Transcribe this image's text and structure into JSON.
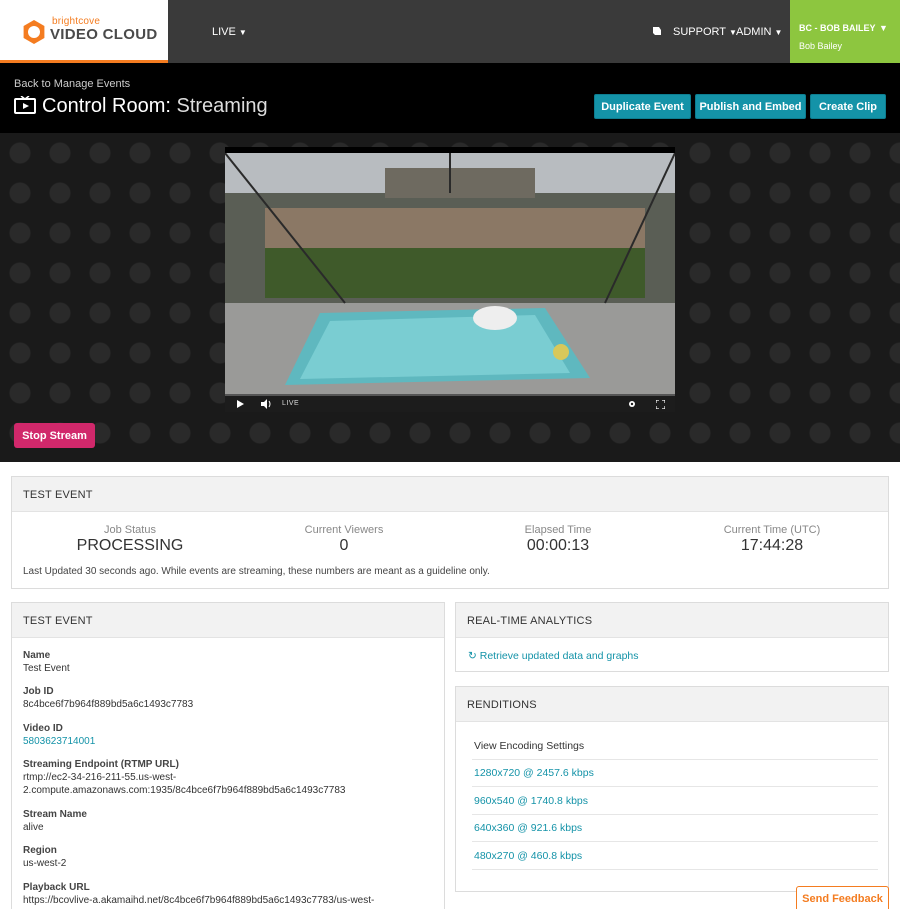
{
  "nav": {
    "logo_small": "brightcove",
    "logo_main": "VIDEO CLOUD",
    "live": "LIVE",
    "support": "SUPPORT",
    "admin": "ADMIN",
    "user_account": "BC - BOB BAILEY",
    "user_name": "Bob Bailey",
    "caret": "▼"
  },
  "header": {
    "back": "Back to Manage Events",
    "title_main": "Control Room:",
    "title_sub": "Streaming",
    "buttons": {
      "duplicate": "Duplicate Event",
      "publish": "Publish and Embed",
      "clip": "Create Clip"
    }
  },
  "player": {
    "live_label": "LIVE",
    "stop_label": "Stop Stream"
  },
  "status_panel": {
    "title": "TEST EVENT",
    "stats": [
      {
        "label": "Job Status",
        "value": "PROCESSING"
      },
      {
        "label": "Current Viewers",
        "value": "0"
      },
      {
        "label": "Elapsed Time",
        "value": "00:00:13"
      },
      {
        "label": "Current Time (UTC)",
        "value": "17:44:28"
      }
    ],
    "note": "Last Updated 30 seconds ago. While events are streaming, these numbers are meant as a guideline only."
  },
  "details_panel": {
    "title": "TEST EVENT",
    "fields": [
      {
        "label": "Name",
        "value": "Test Event"
      },
      {
        "label": "Job ID",
        "value": "8c4bce6f7b964f889bd5a6c1493c7783"
      },
      {
        "label": "Video ID",
        "value": "5803623714001"
      },
      {
        "label": "Streaming Endpoint (RTMP URL)",
        "value_line1": "rtmp://ec2-34-216-211-55.us-west-",
        "value_line2": "2.compute.amazonaws.com:1935/8c4bce6f7b964f889bd5a6c1493c7783"
      },
      {
        "label": "Stream Name",
        "value": "alive"
      },
      {
        "label": "Region",
        "value": "us-west-2"
      },
      {
        "label": "Playback URL",
        "value": "https://bcovlive-a.akamaihd.net/8c4bce6f7b964f889bd5a6c1493c7783/us-west-"
      }
    ]
  },
  "analytics_panel": {
    "title": "REAL-TIME ANALYTICS",
    "refresh_icon": "↻",
    "link": "Retrieve updated data and graphs"
  },
  "renditions_panel": {
    "title": "RENDITIONS",
    "settings": "View Encoding Settings",
    "items": [
      "1280x720 @ 2457.6 kbps",
      "960x540 @ 1740.8 kbps",
      "640x360 @ 921.6 kbps",
      "480x270 @ 460.8 kbps"
    ]
  },
  "feedback": "Send Feedback",
  "colors": {
    "accent_teal": "#1493a8",
    "stop_pink": "#d1286b",
    "user_green": "#8dc63f",
    "brand_orange": "#f47c20"
  }
}
